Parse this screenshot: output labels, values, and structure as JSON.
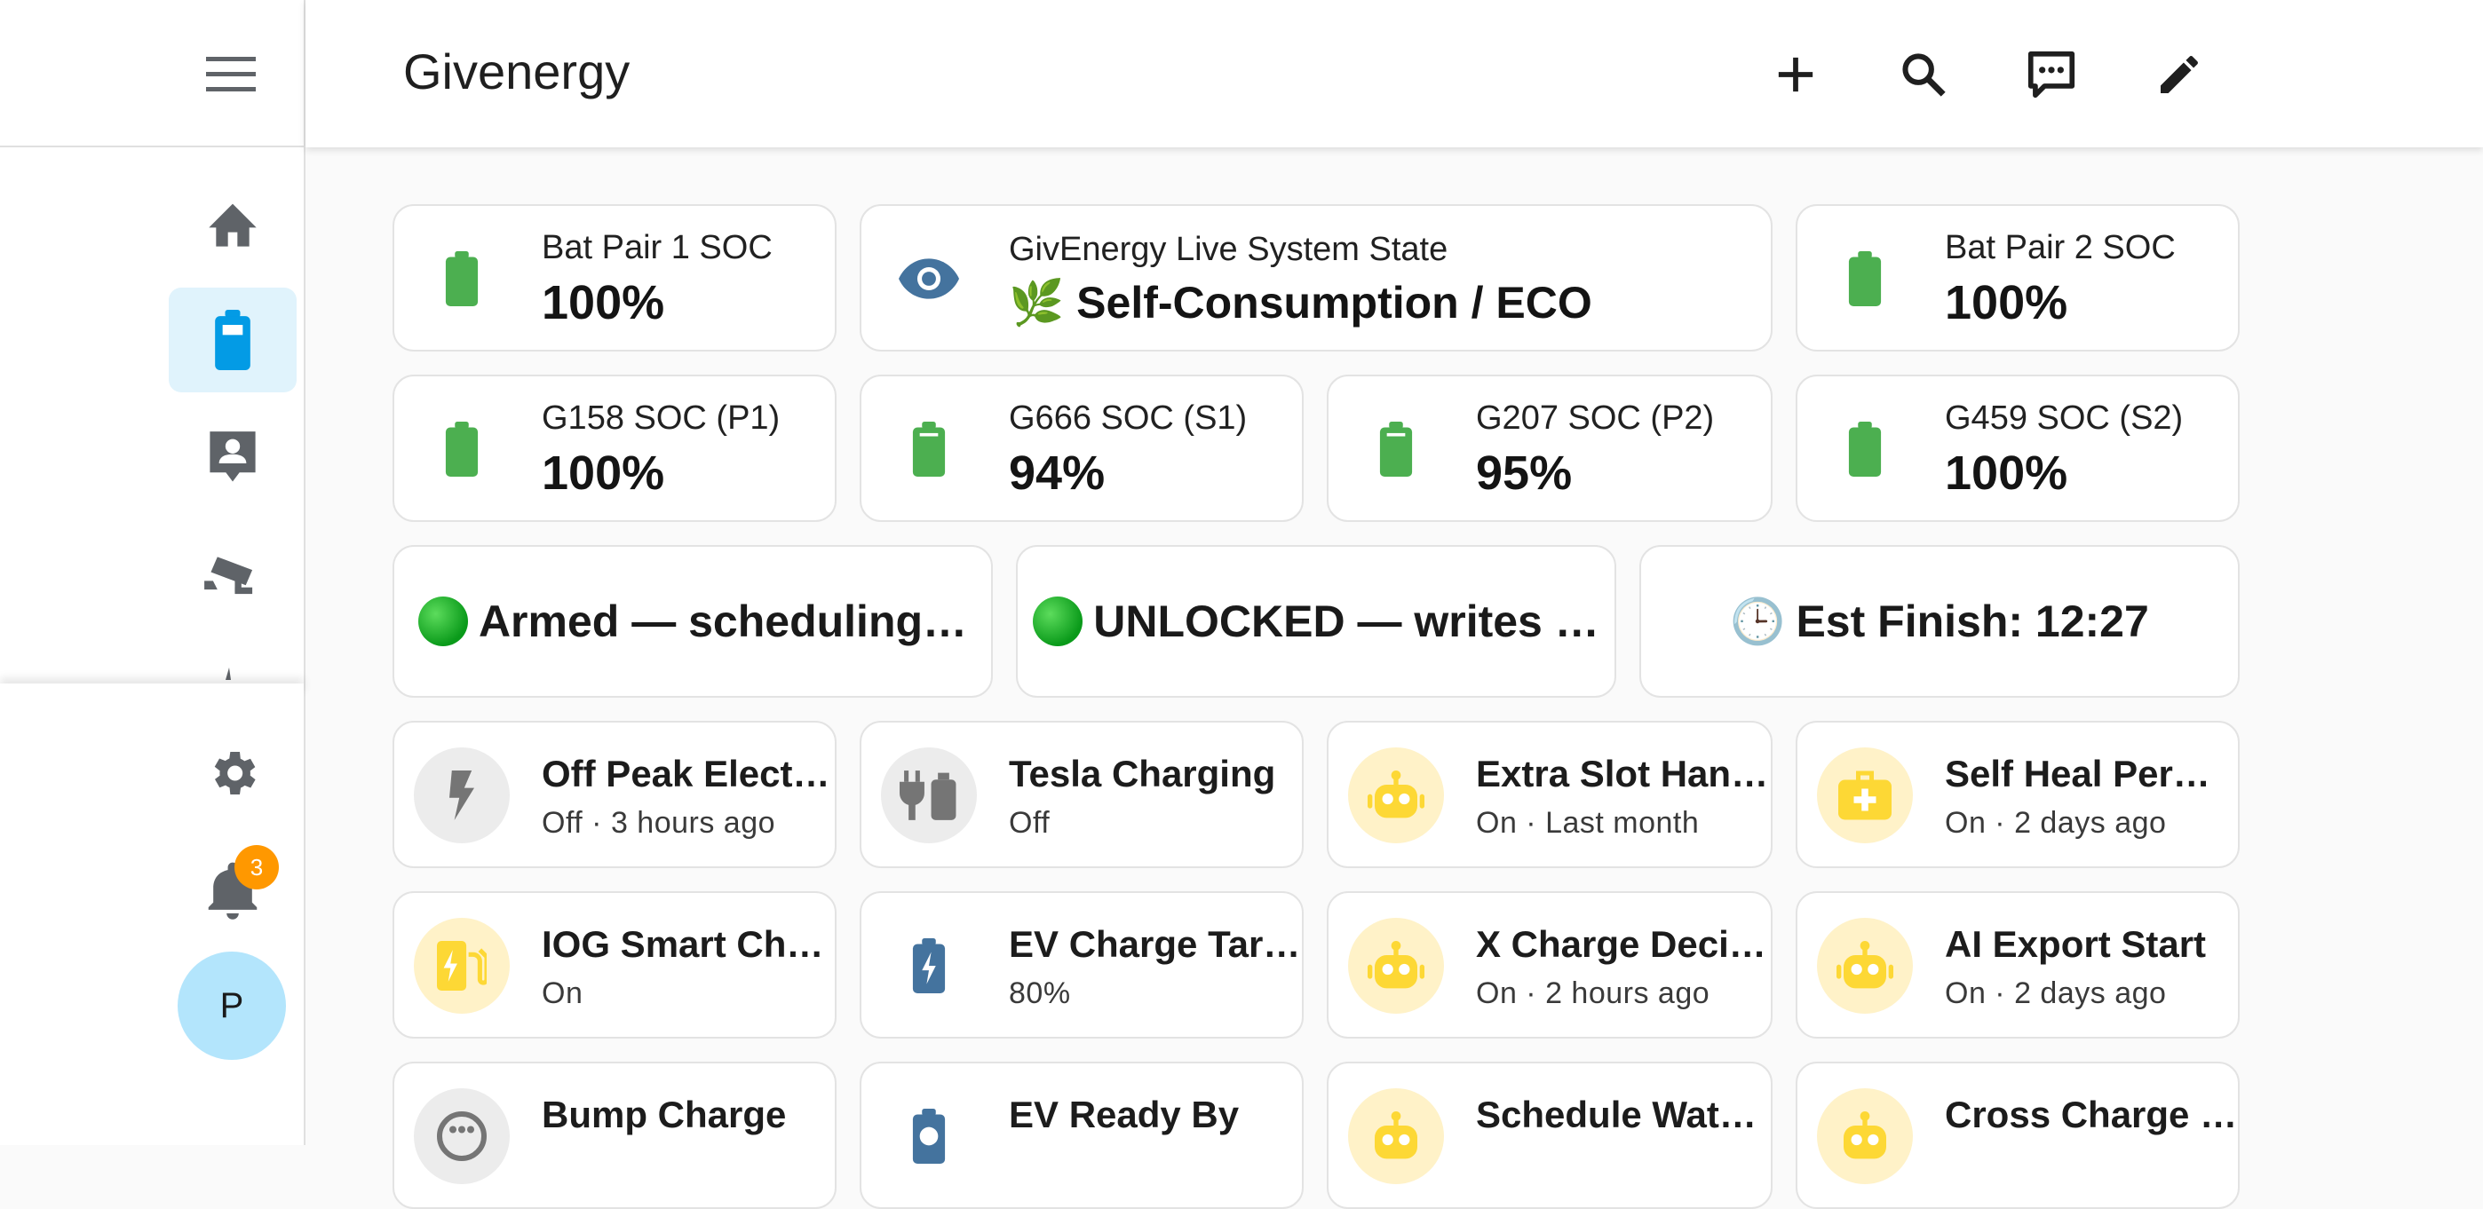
{
  "app": {
    "title": "Givenergy",
    "notification_count": "3",
    "avatar_initial": "P"
  },
  "colors": {
    "battery_green": "#4caf50",
    "accent_blue": "#039be5",
    "eye_blue": "#44739e",
    "robot_yellow": "#fdd835",
    "active_nav_bg": "#e0f3fc"
  },
  "sidebar": {
    "items": [
      {
        "icon": "home-icon"
      },
      {
        "icon": "battery-icon",
        "active": true
      },
      {
        "icon": "account-box-icon"
      },
      {
        "icon": "cctv-icon"
      }
    ],
    "bottom": [
      {
        "icon": "gear-icon"
      },
      {
        "icon": "bell-icon"
      }
    ]
  },
  "toolbar": {
    "actions": [
      "plus-icon",
      "search-icon",
      "chat-icon",
      "pencil-icon"
    ]
  },
  "row1": [
    {
      "label": "Bat Pair 1 SOC",
      "value": "100%"
    },
    {
      "label": "GivEnergy Live System State",
      "emoji": "🌿",
      "value": "Self-Consumption / ECO"
    },
    {
      "label": "Bat Pair 2 SOC",
      "value": "100%"
    }
  ],
  "row2": [
    {
      "label": "G158 SOC (P1)",
      "value": "100%"
    },
    {
      "label": "G666 SOC (S1)",
      "value": "94%"
    },
    {
      "label": "G207 SOC (P2)",
      "value": "95%"
    },
    {
      "label": "G459 SOC (S2)",
      "value": "100%"
    }
  ],
  "banners": [
    {
      "text": "Armed — scheduling…"
    },
    {
      "text": "UNLOCKED — writes …"
    },
    {
      "emoji": "🕒",
      "text": "Est Finish: 12:27"
    }
  ],
  "row4": [
    {
      "name": "Off Peak Elect…",
      "state": "Off · 3 hours ago",
      "icon": "flash-icon"
    },
    {
      "name": "Tesla Charging",
      "state": "Off",
      "icon": "ev-plug-icon"
    },
    {
      "name": "Extra Slot Han…",
      "state": "On · Last month",
      "icon": "robot-icon"
    },
    {
      "name": "Self Heal Per…",
      "state": "On · 2 days ago",
      "icon": "medical-bag-icon"
    }
  ],
  "row5": [
    {
      "name": "IOG Smart Ch…",
      "state": "On",
      "icon": "ev-station-icon"
    },
    {
      "name": "EV Charge Tar…",
      "state": "80%",
      "icon": "battery-charging-icon"
    },
    {
      "name": "X Charge Deci…",
      "state": "On · 2 hours ago",
      "icon": "robot-icon"
    },
    {
      "name": "AI Export Start",
      "state": "On · 2 days ago",
      "icon": "robot-icon"
    }
  ],
  "row6": [
    {
      "name": "Bump Charge",
      "icon": "ev-plug-type2-icon"
    },
    {
      "name": "EV Ready By",
      "icon": "battery-clock-icon"
    },
    {
      "name": "Schedule Wat…",
      "icon": "robot-icon"
    },
    {
      "name": "Cross Charge …",
      "icon": "robot-icon"
    }
  ]
}
